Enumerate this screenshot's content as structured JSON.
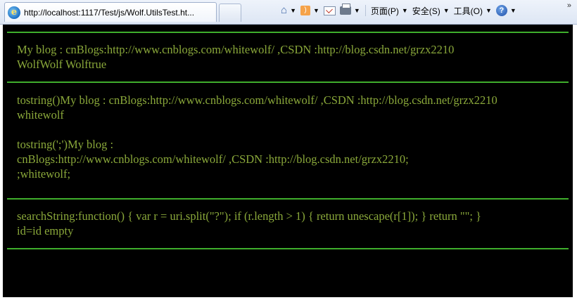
{
  "browser": {
    "tab_title": "http://localhost:1117/Test/js/Wolf.UtilsTest.ht...",
    "toolbar": {
      "page_menu": "页面(P)",
      "safety_menu": "安全(S)",
      "tools_menu": "工具(O)",
      "overflow": "»"
    }
  },
  "page": {
    "section1": {
      "lines": [
        "My blog : cnBlogs:http://www.cnblogs.com/whitewolf/ ,CSDN :http://blog.csdn.net/grzx2210",
        "WolfWolf Wolftrue"
      ]
    },
    "section2": {
      "lines": [
        "tostring()My blog : cnBlogs:http://www.cnblogs.com/whitewolf/ ,CSDN :http://blog.csdn.net/grzx2210",
        "whitewolf",
        "tostring(';')My blog :",
        "cnBlogs:http://www.cnblogs.com/whitewolf/ ,CSDN :http://blog.csdn.net/grzx2210;",
        ";whitewolf;"
      ]
    },
    "section3": {
      "lines": [
        "searchString:function() { var r = uri.split(\"?\"); if (r.length > 1) { return unescape(r[1]); } return \"\"; }",
        "id=id empty"
      ]
    }
  },
  "colors": {
    "page_background": "#000000",
    "text": "#8aa83a",
    "rule": "#3fae2c"
  }
}
